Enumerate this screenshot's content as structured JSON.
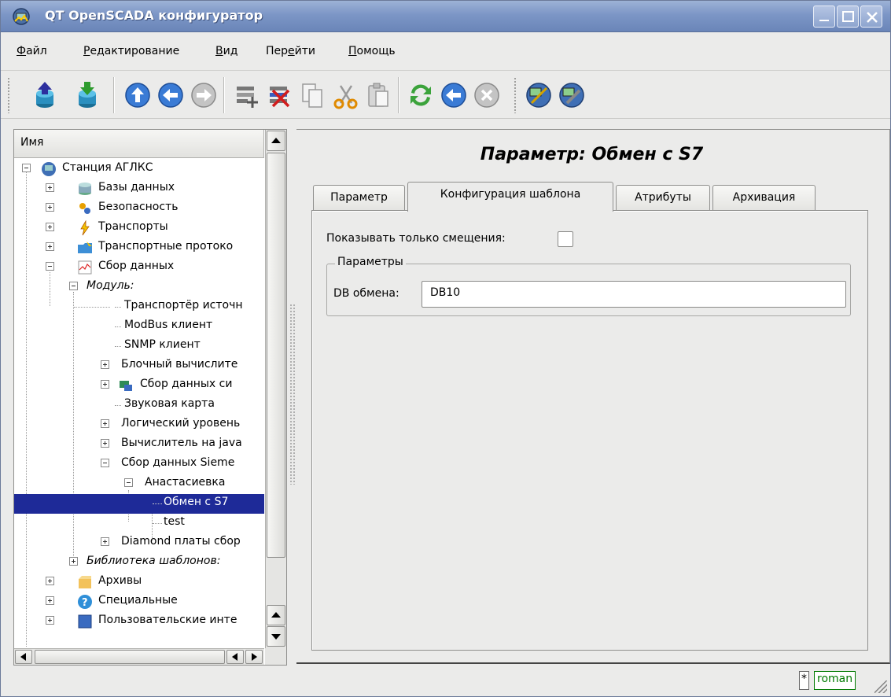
{
  "window": {
    "title": "QT OpenSCADA конфигуратор",
    "titlebar_color": "#7c96c6"
  },
  "menu": {
    "file_u": "Ф",
    "file_rest": "айл",
    "edit_u": "Р",
    "edit_rest": "едактирование",
    "view_u": "В",
    "view_rest": "ид",
    "go_pre": "Пер",
    "go_u": "е",
    "go_rest": "йти",
    "help_u": "П",
    "help_rest": "омощь"
  },
  "toolbar": {
    "icons": [
      "db-load-icon",
      "db-save-icon",
      "up-icon",
      "back-icon",
      "forward-icon",
      "add-item-icon",
      "delete-item-icon",
      "copy-icon",
      "cut-icon",
      "paste-icon",
      "refresh-icon",
      "start-icon",
      "stop-icon",
      "station-icon",
      "station-settings-icon"
    ]
  },
  "tree": {
    "header": "Имя",
    "items": [
      {
        "label": "Станция АГЛКС"
      },
      {
        "label": "Базы данных"
      },
      {
        "label": "Безопасность"
      },
      {
        "label": "Транспорты"
      },
      {
        "label": "Транспортные протоко"
      },
      {
        "label": "Сбор данных"
      },
      {
        "label": "Модуль:"
      },
      {
        "label": "Транспортёр источн"
      },
      {
        "label": "ModBus клиент"
      },
      {
        "label": "SNMP клиент"
      },
      {
        "label": "Блочный вычислите"
      },
      {
        "label": "Сбор данных си"
      },
      {
        "label": "Звуковая карта"
      },
      {
        "label": "Логический уровень"
      },
      {
        "label": "Вычислитель на java"
      },
      {
        "label": "Сбор данных Sieme"
      },
      {
        "label": "Анастасиевка"
      },
      {
        "label": "Обмен с S7"
      },
      {
        "label": "test"
      },
      {
        "label": "Diamond платы сбор"
      },
      {
        "label": "Библиотека шаблонов:"
      },
      {
        "label": "Архивы"
      },
      {
        "label": "Специальные"
      },
      {
        "label": "Пользовательские инте"
      }
    ],
    "selected_color": "#1e2a98"
  },
  "main": {
    "title": "Параметр: Обмен с S7",
    "tabs": [
      {
        "label": "Параметр"
      },
      {
        "label": "Конфигурация шаблона"
      },
      {
        "label": "Атрибуты"
      },
      {
        "label": "Архивация"
      }
    ],
    "active_tab": "Конфигурация шаблона",
    "show_offsets_label": "Показывать только смещения:",
    "show_offsets_checked": false,
    "group_title": "Параметры",
    "db_label": "DB обмена:",
    "db_value": "DB10"
  },
  "status": {
    "modified": "*",
    "user": "roman",
    "user_color": "#007a00"
  }
}
